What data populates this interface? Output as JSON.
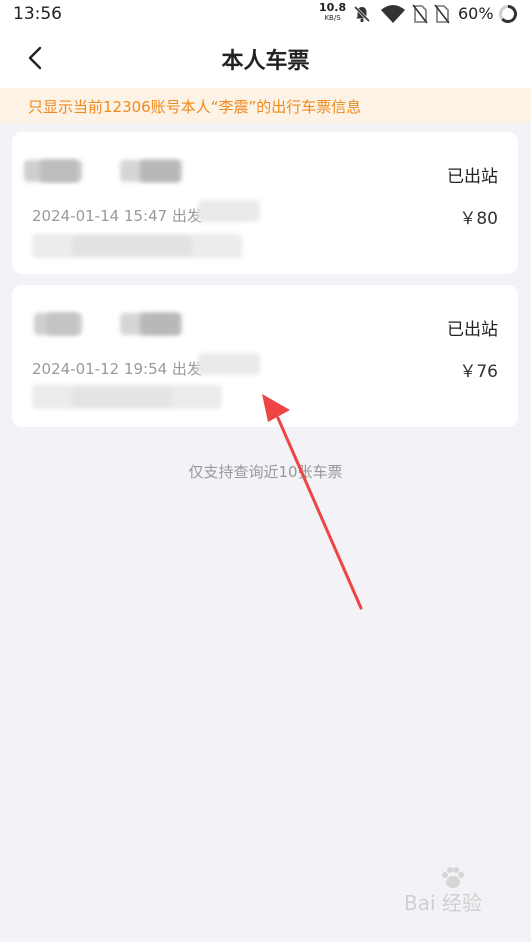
{
  "status_bar": {
    "time": "13:56",
    "net_speed_value": "10.8",
    "net_speed_unit": "KB/S",
    "battery": "60%"
  },
  "header": {
    "title": "本人车票"
  },
  "notice": {
    "text": "只显示当前12306账号本人“李震”的出行车票信息"
  },
  "tickets": [
    {
      "status": "已出站",
      "depart": "2024-01-14  15:47 出发",
      "price": "￥80"
    },
    {
      "status": "已出站",
      "depart": "2024-01-12  19:54 出发",
      "price": "￥76"
    }
  ],
  "footer": {
    "note": "仅支持查询近10张车票"
  },
  "watermark": {
    "text": "Bai 经验"
  },
  "colors": {
    "accent": "#f08a1c",
    "notice_bg": "#fdf2e6",
    "arrow": "#ee4444",
    "page_bg": "#f3f3f7"
  }
}
